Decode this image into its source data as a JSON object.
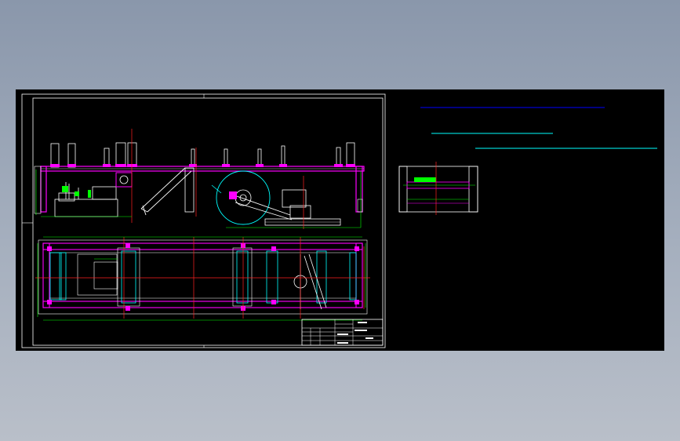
{
  "viewport": {
    "background": "#000000",
    "colors": {
      "frame": "#ffffff",
      "steel": "#ff00ff",
      "outline": "#ffffff",
      "centerline": "#ff2020",
      "dimension": "#00ff00",
      "parts": "#00ffff",
      "leader": "#0000ff"
    }
  },
  "drawing": {
    "sheet_name": "main-sheet",
    "detail_name": "detail-view"
  },
  "title_block": {
    "cells": [
      "",
      "",
      "",
      ""
    ]
  }
}
